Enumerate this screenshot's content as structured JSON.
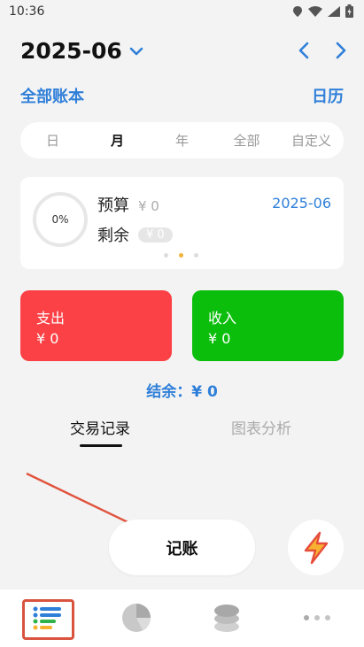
{
  "status_bar": {
    "time": "10:36"
  },
  "header": {
    "month": "2025-06",
    "left_link": "全部账本",
    "right_link": "日历"
  },
  "period_tabs": [
    {
      "label": "日",
      "active": false
    },
    {
      "label": "月",
      "active": true
    },
    {
      "label": "年",
      "active": false
    },
    {
      "label": "全部",
      "active": false
    },
    {
      "label": "自定义",
      "active": false
    }
  ],
  "budget": {
    "percent": "0%",
    "budget_label": "预算",
    "budget_value": "¥ 0",
    "remaining_label": "剩余",
    "remaining_value": "¥ 0",
    "date": "2025-06"
  },
  "expense": {
    "label": "支出",
    "value": "¥ 0",
    "color": "#fb4145"
  },
  "income": {
    "label": "收入",
    "value": "¥ 0",
    "color": "#0cbe0c"
  },
  "balance": {
    "text": "结余：¥ 0"
  },
  "content_tabs": {
    "records": "交易记录",
    "charts": "图表分析"
  },
  "actions": {
    "record": "记账"
  },
  "icons": {
    "flash": "lightning-icon",
    "list": "list-icon",
    "pie": "pie-chart-icon",
    "coins": "coins-icon",
    "more": "more-icon"
  }
}
